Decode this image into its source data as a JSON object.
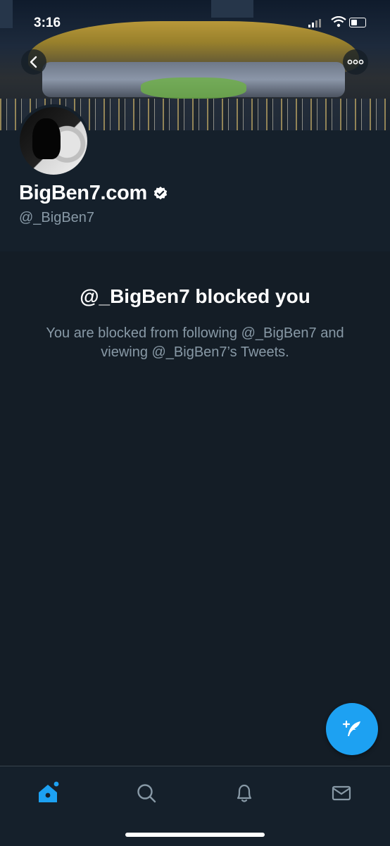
{
  "status_bar": {
    "time": "3:16"
  },
  "profile": {
    "display_name": "BigBen7.com",
    "handle": "@_BigBen7",
    "verified": true
  },
  "blocked": {
    "title": "@_BigBen7 blocked you",
    "message": "You are blocked from following @_BigBen7 and viewing @_BigBen7’s Tweets."
  },
  "icons": {
    "back": "chevron-left-icon",
    "more": "more-dots-icon",
    "compose": "compose-feather-icon",
    "tabs": [
      "home-icon",
      "search-icon",
      "notifications-bell-icon",
      "messages-envelope-icon"
    ]
  },
  "colors": {
    "accent": "#1da1f2",
    "background": "#15202b",
    "secondary_text": "#8899a6"
  }
}
